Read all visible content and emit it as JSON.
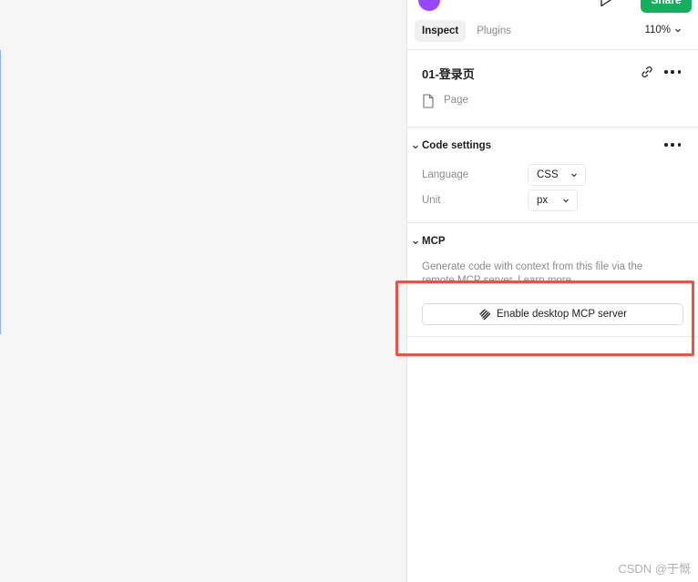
{
  "topbar": {
    "share_label": "Share"
  },
  "tabs": [
    {
      "label": "Inspect",
      "active": true
    },
    {
      "label": "Plugins",
      "active": false
    }
  ],
  "zoom": "110%",
  "file": {
    "title": "01-登录页",
    "type_label": "Page"
  },
  "code_settings": {
    "title": "Code settings",
    "language_label": "Language",
    "language_value": "CSS",
    "unit_label": "Unit",
    "unit_value": "px"
  },
  "mcp": {
    "title": "MCP",
    "description": "Generate code with context from this file via the remote MCP server. Learn more",
    "button_label": "Enable desktop MCP server"
  },
  "watermark": "CSDN @于慨",
  "colors": {
    "share": "#14ae5c",
    "avatar": "#9747ff",
    "highlight": "#e5534b",
    "canvas_edge": "#8ab4f8"
  },
  "icons": [
    "avatar",
    "play-icon",
    "chevron-down-icon",
    "link-icon",
    "more-icon",
    "page-icon",
    "figma-mcp-icon"
  ]
}
